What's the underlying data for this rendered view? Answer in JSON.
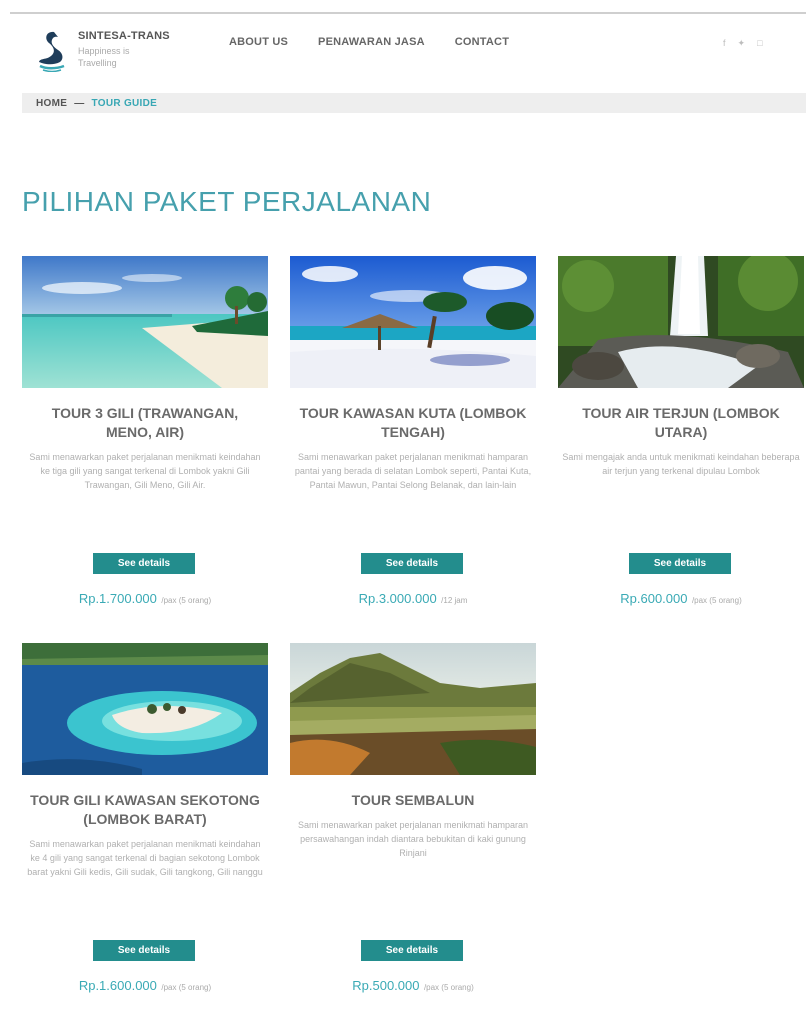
{
  "header": {
    "brand_name": "SINTESA-TRANS",
    "brand_tagline": "Happiness is Travelling",
    "nav": [
      "ABOUT US",
      "PENAWARAN JASA",
      "CONTACT"
    ],
    "social": {
      "facebook": "f",
      "twitter": "✦",
      "instagram": "□"
    }
  },
  "breadcrumb": {
    "home": "HOME",
    "separator": "—",
    "current": "TOUR GUIDE"
  },
  "page_title": "PILIHAN PAKET PERJALANAN",
  "colors": {
    "accent": "#46a0ad",
    "button": "#238d8d",
    "breadcrumb_bg": "#eeeeee"
  },
  "tours": [
    {
      "title": "TOUR 3 GILI (TRAWANGAN, MENO, AIR)",
      "description": "Sami menawarkan paket perjalanan menikmati keindahan ke tiga gili yang sangat terkenal di Lombok yakni Gili Trawangan, Gili Meno, Gili Air.",
      "button": "See details",
      "price": "Rp.1.700.000",
      "price_unit": "/pax (5 orang)",
      "image": "beach-image"
    },
    {
      "title": "TOUR KAWASAN KUTA (LOMBOK TENGAH)",
      "description": "Sami menawarkan paket perjalanan menikmati hamparan pantai yang berada di selatan Lombok seperti, Pantai Kuta, Pantai Mawun, Pantai Selong Belanak, dan lain-lain",
      "button": "See details",
      "price": "Rp.3.000.000",
      "price_unit": "/12 jam",
      "image": "umbrella-beach-image"
    },
    {
      "title": "TOUR AIR TERJUN (LOMBOK UTARA)",
      "description": "Sami mengajak anda untuk menikmati keindahan beberapa air terjun yang terkenal dipulau Lombok",
      "button": "See details",
      "price": "Rp.600.000",
      "price_unit": "/pax (5 orang)",
      "image": "waterfall-image"
    },
    {
      "title": "TOUR GILI KAWASAN SEKOTONG (LOMBOK BARAT)",
      "description": "Sami menawarkan paket perjalanan menikmati keindahan ke 4 gili yang sangat terkenal di bagian sekotong Lombok barat yakni Gili kedis, Gili sudak, Gili tangkong, Gili nanggu",
      "button": "See details",
      "price": "Rp.1.600.000",
      "price_unit": "/pax (5 orang)",
      "image": "island-aerial-image"
    },
    {
      "title": "TOUR SEMBALUN",
      "description": "Sami menawarkan paket perjalanan menikmati hamparan persawahangan indah diantara bebukitan di kaki gunung Rinjani",
      "button": "See details",
      "price": "Rp.500.000",
      "price_unit": "/pax (5 orang)",
      "image": "mountain-valley-image"
    }
  ]
}
